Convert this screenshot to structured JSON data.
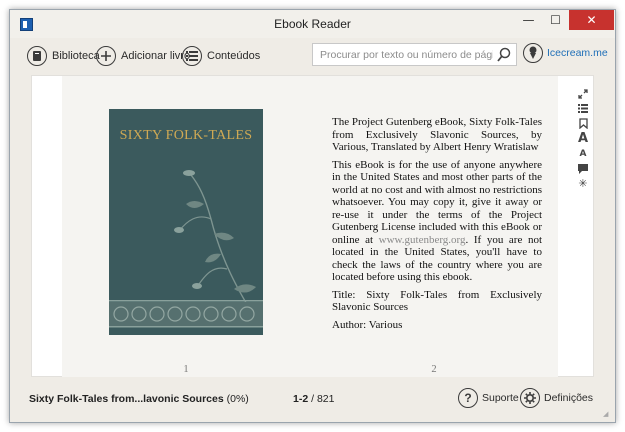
{
  "window": {
    "title": "Ebook Reader",
    "controls": {
      "minimize": "—",
      "maximize": "☐",
      "close": "✕"
    }
  },
  "toolbar": {
    "library_label": "Biblioteca",
    "add_book_label": "Adicionar livro",
    "contents_label": "Conteúdos",
    "search_placeholder": "Procurar por texto ou número de página",
    "icecream_label": "Icecream.me"
  },
  "book": {
    "cover_title": "SIXTY FOLK-TALES",
    "left_page_number": "1",
    "right_page_number": "2",
    "paragraphs": [
      "The Project Gutenberg eBook, Sixty Folk-Tales from Exclusively Slavonic Sources, by Various, Translated by Albert Henry Wratislaw",
      "If you are not located in the United States, you'll have to check the laws of the country where you are located before using this ebook."
    ],
    "license_text_before": "This eBook is for the use of anyone anywhere in the United States and most other parts of the world at no cost and with almost no restrictions whatsoever. You may copy it, give it away or re-use it under the terms of the Project Gutenberg License included with this eBook or online at",
    "license_link": "www.gutenberg.org",
    "license_text_after": ". If you are not located in the United States, you'll have to check the laws of the country where you are located before using this ebook.",
    "title_line": "Title: Sixty Folk-Tales from Exclusively Slavonic Sources",
    "author_line": "Author: Various"
  },
  "side_tools": {
    "icons": [
      "fullscreen-icon",
      "list-icon",
      "bookmark-icon",
      "font-size-icon",
      "font-small-icon",
      "note-icon",
      "brightness-icon"
    ]
  },
  "status": {
    "book_title": "Sixty Folk-Tales from...lavonic Sources",
    "progress": "(0%)",
    "current_pages": "1-2",
    "total_pages": "/ 821",
    "support_label": "Suporte",
    "settings_label": "Definições"
  },
  "colors": {
    "accent_link": "#1f6fb8",
    "close_button": "#c7322e",
    "cover_background": "#3b5a5d",
    "cover_title": "#cfa954"
  }
}
